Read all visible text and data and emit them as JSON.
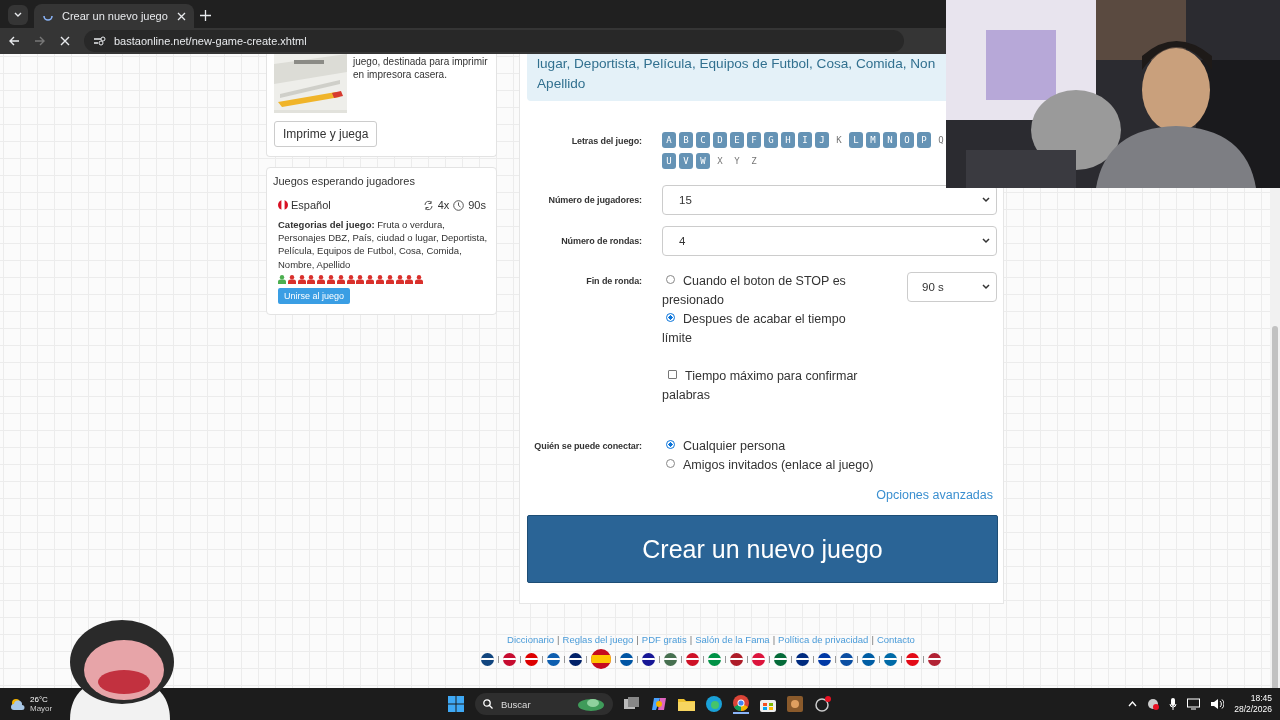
{
  "browser": {
    "tab_title": "Crear un nuevo juego",
    "url": "bastaonline.net/new-game-create.xhtml",
    "loading": true
  },
  "print_card": {
    "description": "juego, destinada para imprimir en impresora casera.",
    "button": "Imprime y juega"
  },
  "waiting_games": {
    "title": "Juegos esperando jugadores",
    "game": {
      "language": "Español",
      "rounds": "4x",
      "time": "90s",
      "categories": "**Categorias del juego:** Fruta o verdura, Personajes DBZ, País, ciudad o lugar, Deportista, Película, Equipos de Futbol, Cosa, Comida, Nombre, Apellido",
      "join_button": "Unirse al juego",
      "players": [
        {
          "joined": true
        },
        {
          "joined": false
        },
        {
          "joined": false
        },
        {
          "joined": false
        },
        {
          "joined": false
        },
        {
          "joined": false
        },
        {
          "joined": false
        },
        {
          "joined": false
        },
        {
          "joined": false
        },
        {
          "joined": false
        },
        {
          "joined": false
        },
        {
          "joined": false
        },
        {
          "joined": false
        },
        {
          "joined": false
        },
        {
          "joined": false
        }
      ]
    }
  },
  "form": {
    "categories_note_lines": [
      "lugar, Deportista, Película, Equipos de Futbol, Cosa, Comida, Non",
      "Apellido"
    ],
    "letters_label": "Letras del juego:",
    "letter_rows": [
      [
        {
          "letter": "A",
          "selected": true
        },
        {
          "letter": "B",
          "selected": true
        },
        {
          "letter": "C",
          "selected": true
        },
        {
          "letter": "D",
          "selected": true
        },
        {
          "letter": "E",
          "selected": true
        },
        {
          "letter": "F",
          "selected": true
        },
        {
          "letter": "G",
          "selected": true
        },
        {
          "letter": "H",
          "selected": true
        },
        {
          "letter": "I",
          "selected": true
        },
        {
          "letter": "J",
          "selected": true
        },
        {
          "letter": "K",
          "selected": false
        },
        {
          "letter": "L",
          "selected": true
        },
        {
          "letter": "M",
          "selected": true
        },
        {
          "letter": "N",
          "selected": true
        },
        {
          "letter": "O",
          "selected": true
        },
        {
          "letter": "P",
          "selected": true
        },
        {
          "letter": "Q",
          "selected": false
        }
      ],
      [
        {
          "letter": "U",
          "selected": true
        },
        {
          "letter": "V",
          "selected": true
        },
        {
          "letter": "W",
          "selected": true
        },
        {
          "letter": "X",
          "selected": false
        },
        {
          "letter": "Y",
          "selected": false
        },
        {
          "letter": "Z",
          "selected": false
        }
      ]
    ],
    "players_label": "Número de jugadores:",
    "players_value": "15",
    "rounds_label": "Número de rondas:",
    "rounds_value": "4",
    "round_end_label": "Fin de ronda:",
    "round_end_options": [
      {
        "label": "Cuando el boton de STOP es presionado",
        "selected": false
      },
      {
        "label": "Despues de acabar el tiempo límite",
        "selected": true
      }
    ],
    "time_limit": "90 s",
    "confirm_time": {
      "label": "Tiempo máximo para confirmar palabras",
      "checked": false
    },
    "who_label": "Quién se puede conectar:",
    "who_options": [
      {
        "label": "Cualquier persona",
        "selected": true
      },
      {
        "label": "Amigos invitados (enlace al juego)",
        "selected": false
      }
    ],
    "advanced_link": "Opciones avanzadas",
    "create_button": "Crear un nuevo juego"
  },
  "footer": {
    "items": [
      {
        "kind": "link",
        "text": "Diccionario"
      },
      {
        "kind": "separator",
        "text": "|"
      },
      {
        "kind": "link",
        "text": "Reglas del juego"
      },
      {
        "kind": "separator",
        "text": "|"
      },
      {
        "kind": "link",
        "text": "PDF gratis"
      },
      {
        "kind": "separator",
        "text": "|"
      },
      {
        "kind": "link",
        "text": "Salón de la Fama"
      },
      {
        "kind": "separator",
        "text": "|"
      },
      {
        "kind": "link",
        "text": "Política de privacidad"
      },
      {
        "kind": "separator",
        "text": "|"
      },
      {
        "kind": "link",
        "text": "Contacto"
      }
    ],
    "flags": [
      {
        "color": "#11457e",
        "selected": false
      },
      {
        "color": "#c60c30",
        "selected": false
      },
      {
        "color": "#dd0000",
        "selected": false
      },
      {
        "color": "#0d5eaf",
        "selected": false
      },
      {
        "color": "#012169",
        "selected": false
      },
      {
        "color": "#c60b1e",
        "selected": true
      },
      {
        "color": "#0055a4",
        "selected": false
      },
      {
        "color": "#171796",
        "selected": false
      },
      {
        "color": "#477050",
        "selected": false
      },
      {
        "color": "#ce1126",
        "selected": false
      },
      {
        "color": "#009246",
        "selected": false
      },
      {
        "color": "#ae1c28",
        "selected": false
      },
      {
        "color": "#dc143c",
        "selected": false
      },
      {
        "color": "#046a38",
        "selected": false
      },
      {
        "color": "#002b7f",
        "selected": false
      },
      {
        "color": "#0039a6",
        "selected": false
      },
      {
        "color": "#0b4ea2",
        "selected": false
      },
      {
        "color": "#005da4",
        "selected": false
      },
      {
        "color": "#006aa7",
        "selected": false
      },
      {
        "color": "#e30a17",
        "selected": false
      },
      {
        "color": "#b22234",
        "selected": false
      }
    ]
  },
  "taskbar": {
    "temperature": "26°C",
    "weather_text": "Mayor",
    "search_placeholder": "Buscar",
    "time": "18:45",
    "date": "28/2/2026"
  }
}
